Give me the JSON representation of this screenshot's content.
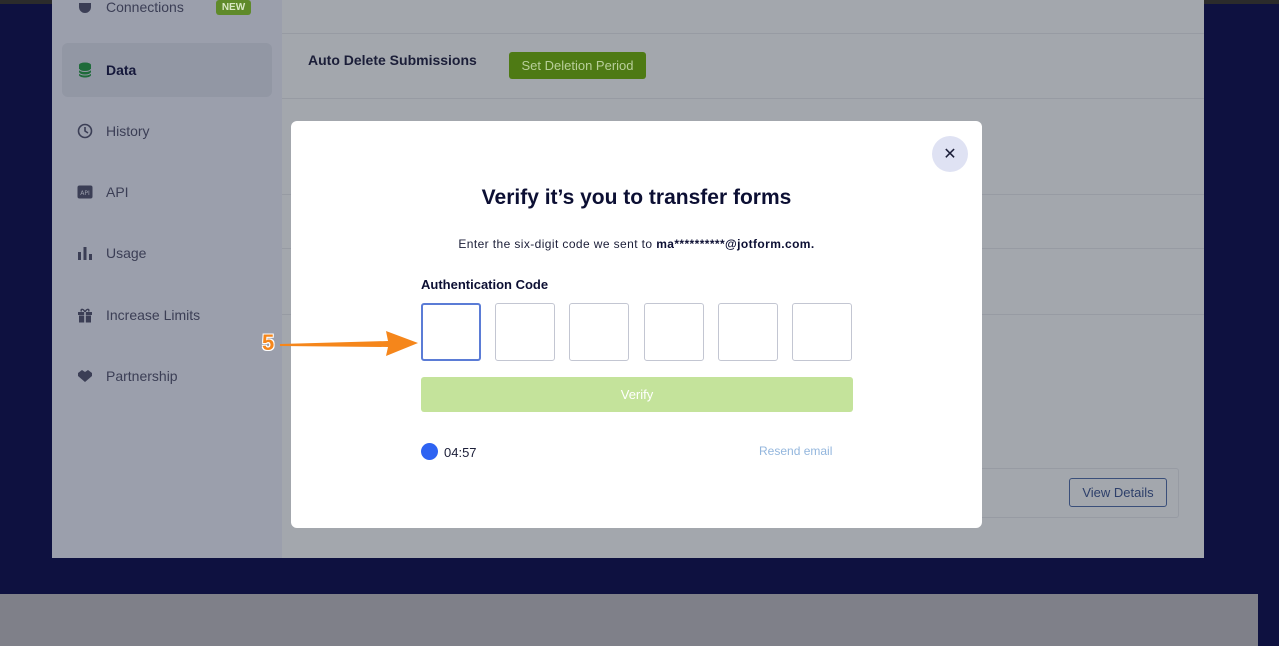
{
  "sidebar": {
    "items": [
      {
        "label": "Connections",
        "icon": "plug-icon",
        "badge": "NEW"
      },
      {
        "label": "Data",
        "icon": "database-icon",
        "active": true
      },
      {
        "label": "History",
        "icon": "history-icon"
      },
      {
        "label": "API",
        "icon": "api-icon"
      },
      {
        "label": "Usage",
        "icon": "bar-chart-icon"
      },
      {
        "label": "Increase Limits",
        "icon": "gift-icon"
      },
      {
        "label": "Partnership",
        "icon": "handshake-icon"
      }
    ]
  },
  "content": {
    "auto_delete_label": "Auto Delete Submissions",
    "set_deletion_label": "Set Deletion Period",
    "view_details_label": "View Details"
  },
  "modal": {
    "title": "Verify it’s you to transfer forms",
    "subtitle_prefix": "Enter the six-digit code we sent to ",
    "email": "ma**********@jotform.com.",
    "auth_label": "Authentication Code",
    "code_digits": [
      "",
      "",
      "",
      "",
      "",
      ""
    ],
    "verify_label": "Verify",
    "timer": "04:57",
    "resend_label": "Resend email",
    "close_symbol": "✕"
  },
  "annotation": {
    "step_number": "5"
  },
  "colors": {
    "accent_green": "#4e7a14",
    "verify_disabled": "#c4e39b",
    "timer_blue": "#2e63f2",
    "annotation_orange": "#f5861b",
    "backdrop": "#0e1140"
  }
}
